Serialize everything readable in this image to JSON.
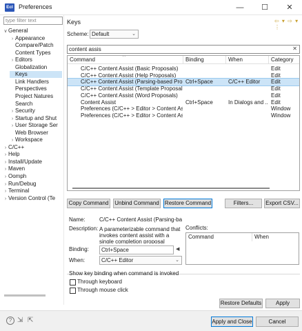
{
  "window": {
    "app_icon_text": "Ecl",
    "title": "Preferences",
    "minimize_glyph": "—",
    "maximize_glyph": "☐",
    "close_glyph": "✕"
  },
  "sidebar": {
    "filter_placeholder": "type filter text",
    "tree": [
      {
        "label": "General",
        "twistie": "∨",
        "indent": 0
      },
      {
        "label": "Appearance",
        "twistie": "›",
        "indent": 1
      },
      {
        "label": "Compare/Patch",
        "twistie": "",
        "indent": 1
      },
      {
        "label": "Content Types",
        "twistie": "",
        "indent": 1
      },
      {
        "label": "Editors",
        "twistie": "›",
        "indent": 1
      },
      {
        "label": "Globalization",
        "twistie": "",
        "indent": 1
      },
      {
        "label": "Keys",
        "twistie": "",
        "indent": 1,
        "selected": true
      },
      {
        "label": "Link Handlers",
        "twistie": "",
        "indent": 1
      },
      {
        "label": "Perspectives",
        "twistie": "",
        "indent": 1
      },
      {
        "label": "Project Natures",
        "twistie": "",
        "indent": 1
      },
      {
        "label": "Search",
        "twistie": "",
        "indent": 1
      },
      {
        "label": "Security",
        "twistie": "›",
        "indent": 1
      },
      {
        "label": "Startup and Shut",
        "twistie": "›",
        "indent": 1
      },
      {
        "label": "User Storage Ser",
        "twistie": "›",
        "indent": 1
      },
      {
        "label": "Web Browser",
        "twistie": "",
        "indent": 1
      },
      {
        "label": "Workspace",
        "twistie": "›",
        "indent": 1
      },
      {
        "label": "C/C++",
        "twistie": "›",
        "indent": 0
      },
      {
        "label": "Help",
        "twistie": "›",
        "indent": 0
      },
      {
        "label": "Install/Update",
        "twistie": "›",
        "indent": 0
      },
      {
        "label": "Maven",
        "twistie": "›",
        "indent": 0
      },
      {
        "label": "Oomph",
        "twistie": "›",
        "indent": 0
      },
      {
        "label": "Run/Debug",
        "twistie": "›",
        "indent": 0
      },
      {
        "label": "Terminal",
        "twistie": "›",
        "indent": 0
      },
      {
        "label": "Version Control (Te",
        "twistie": "›",
        "indent": 0
      }
    ]
  },
  "page": {
    "title": "Keys",
    "nav_icons": "⇦ ▾ ⇨ ▾ ⋮",
    "scheme_label": "Scheme:",
    "scheme_value": "Default",
    "search_value": "content assis",
    "search_clear": "✕",
    "table": {
      "headers": [
        "Command",
        "Binding",
        "When",
        "Category"
      ],
      "sort_glyph": "^",
      "rows": [
        [
          "C/C++ Content Assist (Basic Proposals)",
          "",
          "",
          "Edit"
        ],
        [
          "C/C++ Content Assist (Help Proposals)",
          "",
          "",
          "Edit"
        ],
        [
          "C/C++ Content Assist (Parsing-based Prop",
          "Ctrl+Space",
          "C/C++ Editor",
          "Edit"
        ],
        [
          "C/C++ Content Assist (Template Proposals",
          "",
          "",
          "Edit"
        ],
        [
          "C/C++ Content Assist (Word Proposals)",
          "",
          "",
          "Edit"
        ],
        [
          "Content Assist",
          "Ctrl+Space",
          "In Dialogs and ...",
          "Edit"
        ],
        [
          "Preferences (C/C++ > Editor > Content As",
          "",
          "",
          "Window"
        ],
        [
          "Preferences (C/C++ > Editor > Content Assi",
          "",
          "",
          "Window"
        ]
      ],
      "selected_row": 2
    },
    "buttons": {
      "copy_command": "Copy Command",
      "unbind_command": "Unbind Command",
      "restore_command": "Restore Command",
      "filters": "Filters...",
      "export_csv": "Export CSV..."
    },
    "details": {
      "name_label": "Name:",
      "name_value": "C/C++ Content Assist (Parsing-bas",
      "description_label": "Description:",
      "description_value": "A parameterizable command that invokes content assist with a single completion proposal",
      "conflicts_label": "Conflicts:",
      "conflicts_headers": [
        "Command",
        "When"
      ],
      "binding_label": "Binding:",
      "binding_value": "Ctrl+Space",
      "binding_arrow": "◀",
      "when_label": "When:",
      "when_value": "C/C++ Editor"
    },
    "show_binding": {
      "legend": "Show key binding when command is invoked",
      "through_keyboard": "Through keyboard",
      "through_mouse": "Through mouse click"
    },
    "restore_defaults": "Restore Defaults",
    "apply": "Apply"
  },
  "footer": {
    "help_icon": "?",
    "import_icon": "⇲",
    "export_icon": "⇱",
    "apply_and_close": "Apply and Close",
    "cancel": "Cancel"
  }
}
